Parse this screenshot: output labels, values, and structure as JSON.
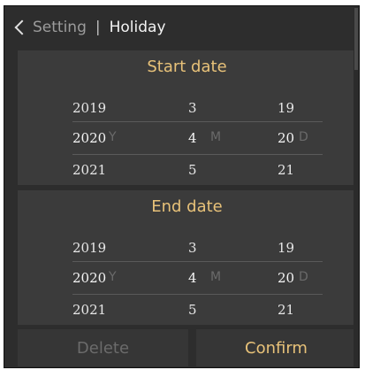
{
  "header": {
    "back_label": "Setting",
    "separator": "|",
    "title": "Holiday"
  },
  "start": {
    "title": "Start date",
    "rows": [
      {
        "year": "2019",
        "month": "3",
        "day": "19"
      },
      {
        "year": "2020",
        "month": "4",
        "day": "20"
      },
      {
        "year": "2021",
        "month": "5",
        "day": "21"
      }
    ]
  },
  "end": {
    "title": "End date",
    "rows": [
      {
        "year": "2019",
        "month": "3",
        "day": "19"
      },
      {
        "year": "2020",
        "month": "4",
        "day": "20"
      },
      {
        "year": "2021",
        "month": "5",
        "day": "21"
      }
    ]
  },
  "units": {
    "year": "Y",
    "month": "M",
    "day": "D"
  },
  "buttons": {
    "delete": "Delete",
    "confirm": "Confirm"
  },
  "colors": {
    "accent": "#e8c279",
    "panel": "#3b3b3b",
    "background": "#2d2d2d"
  }
}
